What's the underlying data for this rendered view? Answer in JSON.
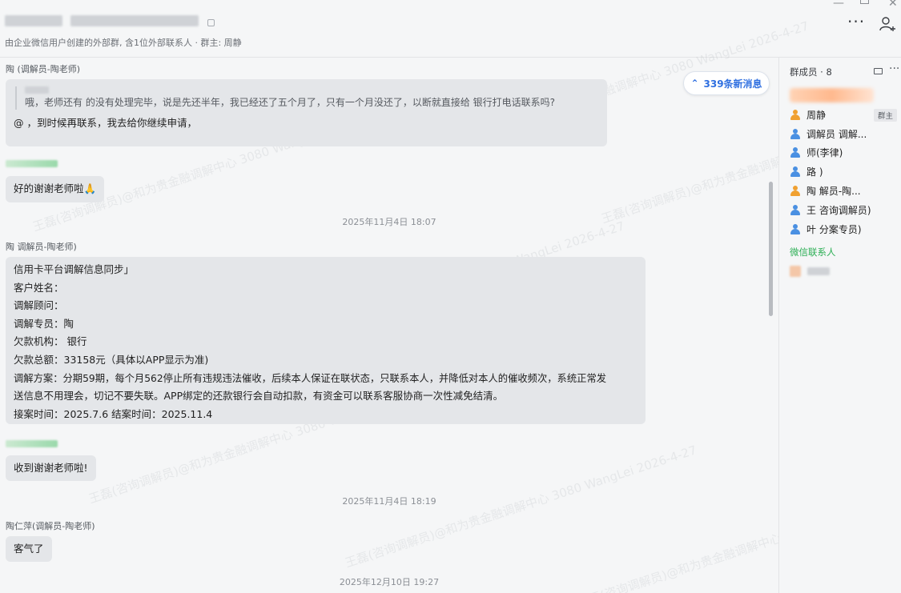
{
  "header": {
    "subtitle": "由企业微信用户创建的外部群, 含1位外部联系人 · 群主: 周静",
    "more_label": "···"
  },
  "chat": {
    "new_messages_label": "339条新消息",
    "messages": [
      {
        "sender": "陶    (调解员-陶老师)",
        "quote": "哦，老师还有     的没有处理完毕，说是先还半年，我已经还了五个月了，只有一个月没还了，以断就直接给     银行打电话联系吗?",
        "text": "@         ，到时候再联系，我去给你继续申请，"
      },
      {
        "text": "好的谢谢老师啦🙏"
      },
      {
        "timestamp": "2025年11月4日 18:07"
      },
      {
        "sender": "陶    调解员-陶老师)",
        "lines": [
          "信用卡平台调解信息同步」",
          "客户姓名：",
          "调解顾问：",
          "调解专员：陶",
          "欠款机构：      银行",
          "欠款总额：33158元（具体以APP显示为准)",
          "调解方案：分期59期，每个月562停止所有违规违法催收，后续本人保证在联状态，只联系本人，并降低对本人的催收频次，系统正常发",
          "送信息不用理会，切记不要失联。APP绑定的还款银行会自动扣款，有资金可以联系客服协商一次性减免结清。",
          "接案时间：2025.7.6  结案时间：2025.11.4"
        ]
      },
      {
        "text": "收到谢谢老师啦!"
      },
      {
        "timestamp": "2025年11月4日 18:19"
      },
      {
        "sender": "陶仁萍(调解员-陶老师)",
        "text": "客气了"
      },
      {
        "timestamp": "2025年12月10日 19:27"
      }
    ]
  },
  "panel": {
    "title": "群成员 · 8",
    "owner_tag": "群主",
    "members": [
      {
        "name": "周静",
        "color": "#f0a030"
      },
      {
        "name": "调解员          调解...",
        "color": "#4a90e2"
      },
      {
        "name": "        师(李律)",
        "color": "#4a90e2"
      },
      {
        "name": "路           )",
        "color": "#4a90e2"
      },
      {
        "name": "陶           解员-陶...",
        "color": "#f0a030"
      },
      {
        "name": "王    咨询调解员)",
        "color": "#4a90e2"
      },
      {
        "name": "叶       分案专员)",
        "color": "#4a90e2"
      }
    ],
    "wx_label": "微信联系人"
  },
  "watermark": "王磊(咨询调解员)@和为贵金融调解中心 3080  WangLei 2026-4-27",
  "colors": {
    "accent": "#2f6fe0",
    "wx_green": "#2bae54",
    "bubble": "#e4e6e9"
  }
}
